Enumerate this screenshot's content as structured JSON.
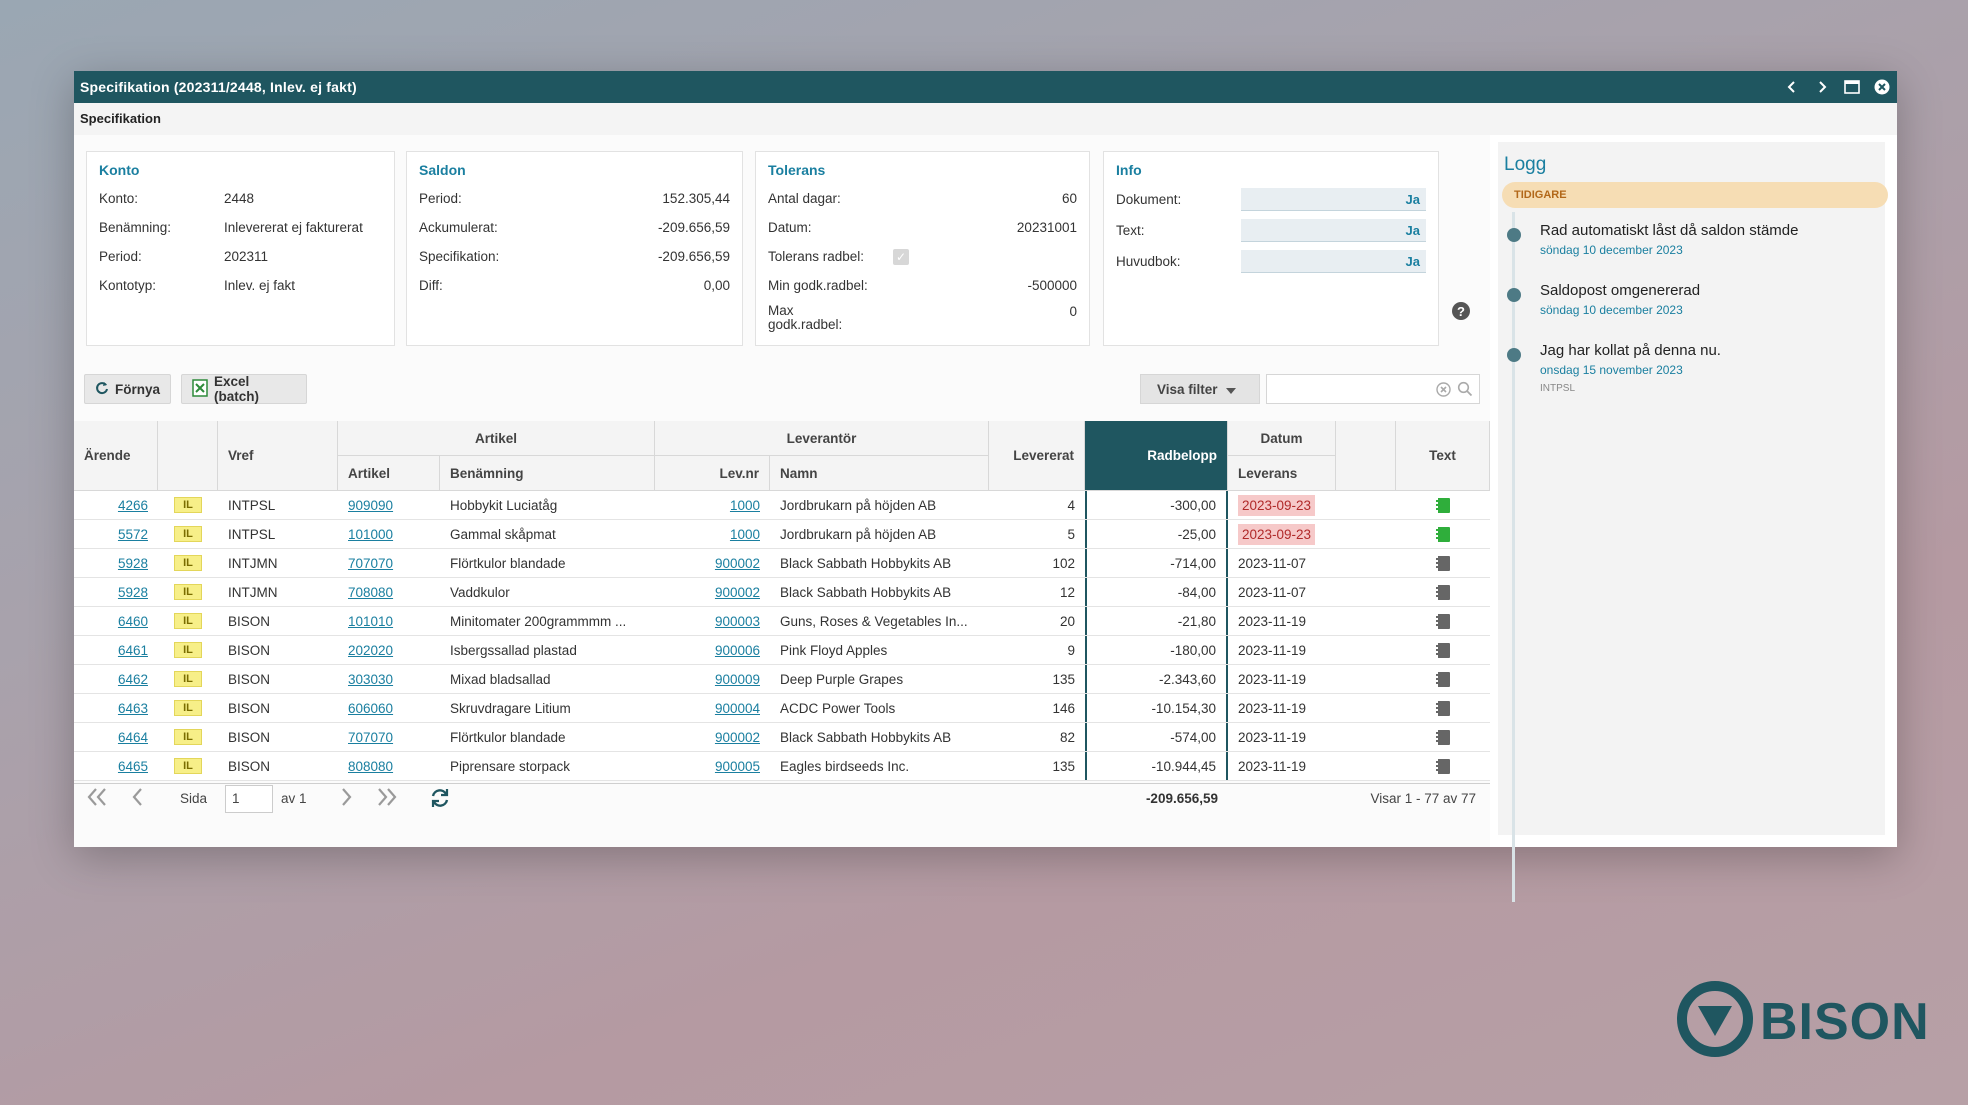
{
  "window": {
    "title": "Specifikation (202311/2448, Inlev. ej fakt)",
    "subtitle": "Specifikation"
  },
  "konto": {
    "heading": "Konto",
    "rows": [
      {
        "label": "Konto:",
        "value": "2448"
      },
      {
        "label": "Benämning:",
        "value": "Inlevererat ej fakturerat"
      },
      {
        "label": "Period:",
        "value": "202311"
      },
      {
        "label": "Kontotyp:",
        "value": "Inlev. ej fakt"
      }
    ]
  },
  "saldon": {
    "heading": "Saldon",
    "rows": [
      {
        "label": "Period:",
        "value": "152.305,44"
      },
      {
        "label": "Ackumulerat:",
        "value": "-209.656,59"
      },
      {
        "label": "Specifikation:",
        "value": "-209.656,59"
      },
      {
        "label": "Diff:",
        "value": "0,00"
      }
    ]
  },
  "tolerans": {
    "heading": "Tolerans",
    "rows": [
      {
        "label": "Antal dagar:",
        "value": "60"
      },
      {
        "label": "Datum:",
        "value": "20231001"
      },
      {
        "label": "Tolerans radbel:",
        "value": ""
      },
      {
        "label": "Min godk.radbel:",
        "value": "-500000"
      },
      {
        "label": "Max godk.radbel:",
        "value": "0"
      }
    ],
    "tolerans_radbel_checked": true
  },
  "info": {
    "heading": "Info",
    "rows": [
      {
        "label": "Dokument:",
        "value": "Ja"
      },
      {
        "label": "Text:",
        "value": "Ja"
      },
      {
        "label": "Huvudbok:",
        "value": "Ja"
      }
    ],
    "help_label": "?"
  },
  "toolbar": {
    "fornya_label": "Förnya",
    "excel_label": "Excel (batch)",
    "filter_label": "Visa filter",
    "search_value": ""
  },
  "grid": {
    "groups": {
      "artikel": "Artikel",
      "leverantor": "Leverantör",
      "datum": "Datum"
    },
    "columns": {
      "arende": "Ärende",
      "vref": "Vref",
      "artikel": "Artikel",
      "benamning": "Benämning",
      "levnr": "Lev.nr",
      "namn": "Namn",
      "levererat": "Levererat",
      "radbelopp": "Radbelopp",
      "leverans": "Leverans",
      "text": "Text"
    },
    "rows": [
      {
        "arende": "4266",
        "typ": "IL",
        "vref": "INTPSL",
        "artikel": "909090",
        "benamning": "Hobbykit Luciatåg",
        "levnr": "1000",
        "namn": "Jordbrukarn på höjden AB",
        "levererat": "4",
        "radbelopp": "-300,00",
        "leverans": "2023-09-23",
        "overdue": true,
        "has_text": true
      },
      {
        "arende": "5572",
        "typ": "IL",
        "vref": "INTPSL",
        "artikel": "101000",
        "benamning": "Gammal skåpmat",
        "levnr": "1000",
        "namn": "Jordbrukarn på höjden AB",
        "levererat": "5",
        "radbelopp": "-25,00",
        "leverans": "2023-09-23",
        "overdue": true,
        "has_text": true
      },
      {
        "arende": "5928",
        "typ": "IL",
        "vref": "INTJMN",
        "artikel": "707070",
        "benamning": "Flörtkulor blandade",
        "levnr": "900002",
        "namn": "Black Sabbath Hobbykits AB",
        "levererat": "102",
        "radbelopp": "-714,00",
        "leverans": "2023-11-07",
        "overdue": false,
        "has_text": false
      },
      {
        "arende": "5928",
        "typ": "IL",
        "vref": "INTJMN",
        "artikel": "708080",
        "benamning": "Vaddkulor",
        "levnr": "900002",
        "namn": "Black Sabbath Hobbykits AB",
        "levererat": "12",
        "radbelopp": "-84,00",
        "leverans": "2023-11-07",
        "overdue": false,
        "has_text": false
      },
      {
        "arende": "6460",
        "typ": "IL",
        "vref": "BISON",
        "artikel": "101010",
        "benamning": "Minitomater 200grammmm ...",
        "levnr": "900003",
        "namn": "Guns, Roses & Vegetables In...",
        "levererat": "20",
        "radbelopp": "-21,80",
        "leverans": "2023-11-19",
        "overdue": false,
        "has_text": false
      },
      {
        "arende": "6461",
        "typ": "IL",
        "vref": "BISON",
        "artikel": "202020",
        "benamning": "Isbergssallad plastad",
        "levnr": "900006",
        "namn": "Pink Floyd Apples",
        "levererat": "9",
        "radbelopp": "-180,00",
        "leverans": "2023-11-19",
        "overdue": false,
        "has_text": false
      },
      {
        "arende": "6462",
        "typ": "IL",
        "vref": "BISON",
        "artikel": "303030",
        "benamning": "Mixad bladsallad",
        "levnr": "900009",
        "namn": "Deep Purple Grapes",
        "levererat": "135",
        "radbelopp": "-2.343,60",
        "leverans": "2023-11-19",
        "overdue": false,
        "has_text": false
      },
      {
        "arende": "6463",
        "typ": "IL",
        "vref": "BISON",
        "artikel": "606060",
        "benamning": "Skruvdragare Litium",
        "levnr": "900004",
        "namn": "ACDC Power Tools",
        "levererat": "146",
        "radbelopp": "-10.154,30",
        "leverans": "2023-11-19",
        "overdue": false,
        "has_text": false
      },
      {
        "arende": "6464",
        "typ": "IL",
        "vref": "BISON",
        "artikel": "707070",
        "benamning": "Flörtkulor blandade",
        "levnr": "900002",
        "namn": "Black Sabbath Hobbykits AB",
        "levererat": "82",
        "radbelopp": "-574,00",
        "leverans": "2023-11-19",
        "overdue": false,
        "has_text": false
      },
      {
        "arende": "6465",
        "typ": "IL",
        "vref": "BISON",
        "artikel": "808080",
        "benamning": "Piprensare storpack",
        "levnr": "900005",
        "namn": "Eagles birdseeds Inc.",
        "levererat": "135",
        "radbelopp": "-10.944,45",
        "leverans": "2023-11-19",
        "overdue": false,
        "has_text": false
      }
    ],
    "sum_radbelopp": "-209.656,59"
  },
  "pager": {
    "page_label": "Sida",
    "page_value": "1",
    "of_label": "av 1",
    "status": "Visar 1 - 77 av 77"
  },
  "log": {
    "title": "Logg",
    "section": "TIDIGARE",
    "entries": [
      {
        "text": "Rad automatiskt låst då saldon stämde",
        "date": "söndag 10 december 2023",
        "user": ""
      },
      {
        "text": "Saldopost omgenererad",
        "date": "söndag 10 december 2023",
        "user": ""
      },
      {
        "text": "Jag har kollat på denna nu.",
        "date": "onsdag 15 november 2023",
        "user": "INTPSL"
      }
    ]
  },
  "brand": {
    "name": "BISON"
  },
  "colors": {
    "accent": "#1f5660",
    "link": "#1a7fa0",
    "overdue_bg": "#f6c9c9",
    "text_icon_green": "#2fae3b",
    "text_icon_gray": "#666666"
  }
}
